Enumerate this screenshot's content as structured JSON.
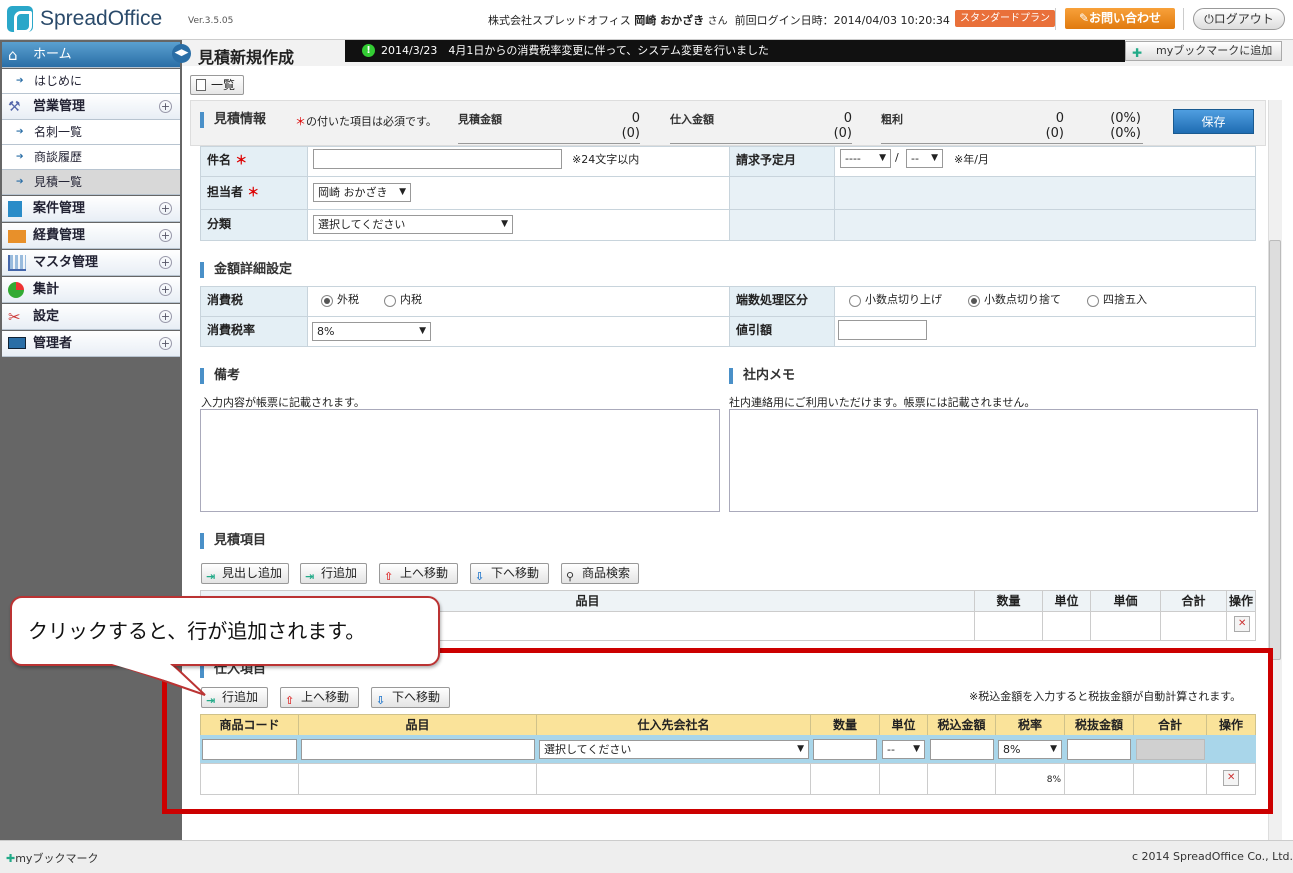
{
  "header": {
    "logo": "SpreadOffice",
    "version": "Ver.3.5.05",
    "company": "株式会社スプレッドオフィス",
    "user_name": "岡崎 おかざき",
    "user_suffix": "さん",
    "last_login": "前回ログイン日時：2014/04/03 10:20:34",
    "plan": "スタンダードプラン",
    "contact": "お問い合わせ",
    "logout": "ログアウト"
  },
  "sidebar": {
    "items": [
      {
        "label": "ホーム",
        "type": "home"
      },
      {
        "label": "はじめに",
        "type": "sub"
      },
      {
        "label": "営業管理",
        "type": "group"
      },
      {
        "label": "名刺一覧",
        "type": "sub"
      },
      {
        "label": "商談履歴",
        "type": "sub"
      },
      {
        "label": "見積一覧",
        "type": "sub",
        "active": true
      },
      {
        "label": "案件管理",
        "type": "group"
      },
      {
        "label": "経費管理",
        "type": "group"
      },
      {
        "label": "マスタ管理",
        "type": "group"
      },
      {
        "label": "集計",
        "type": "group"
      },
      {
        "label": "設定",
        "type": "group"
      },
      {
        "label": "管理者",
        "type": "group"
      }
    ]
  },
  "titlebar": {
    "title": "見積新規作成",
    "notice": "2014/3/23　4月1日からの消費税率変更に伴って、システム変更を行いました",
    "bookmark_add": "myブックマークに追加"
  },
  "list_button": "一覧",
  "summary": {
    "title": "見積情報",
    "required_note": "の付いた項目は必須です。",
    "estimate_label": "見積金額",
    "estimate_value": "0",
    "estimate_sub": "(0)",
    "purchase_label": "仕入金額",
    "purchase_value": "0",
    "purchase_sub": "(0)",
    "profit_label": "粗利",
    "profit_value": "0",
    "profit_sub": "(0)",
    "profit_pct": "(0%)",
    "profit_pct_sub": "(0%)",
    "save": "保存"
  },
  "form": {
    "subject_label": "件名",
    "subject_value": "",
    "subject_note": "※24文字以内",
    "billing_label": "請求予定月",
    "billing_year": "----",
    "billing_sep": "/",
    "billing_month": "--",
    "billing_note": "※年/月",
    "owner_label": "担当者",
    "owner_value": "岡崎 おかざき",
    "category_label": "分類",
    "category_value": "選択してください"
  },
  "amount": {
    "title": "金額詳細設定",
    "tax_label": "消費税",
    "tax_opt1": "外税",
    "tax_opt2": "内税",
    "rounding_label": "端数処理区分",
    "round_opt1": "小数点切り上げ",
    "round_opt2": "小数点切り捨て",
    "round_opt3": "四捨五入",
    "rate_label": "消費税率",
    "rate_value": "8%",
    "discount_label": "値引額",
    "discount_value": ""
  },
  "remarks": {
    "title": "備考",
    "note": "入力内容が帳票に記載されます。",
    "memo_title": "社内メモ",
    "memo_note": "社内連絡用にご利用いただけます。帳票には記載されません。"
  },
  "estimate_items": {
    "title": "見積項目",
    "btn_heading": "見出し追加",
    "btn_row": "行追加",
    "btn_up": "上へ移動",
    "btn_down": "下へ移動",
    "btn_search": "商品検索",
    "columns": [
      "品目",
      "数量",
      "単位",
      "単価",
      "合計",
      "操作"
    ]
  },
  "purchase_items": {
    "title": "仕入項目",
    "btn_row": "行追加",
    "btn_up": "上へ移動",
    "btn_down": "下へ移動",
    "note": "※税込金額を入力すると税抜金額が自動計算されます。",
    "columns": [
      "商品コード",
      "品目",
      "仕入先会社名",
      "数量",
      "単位",
      "税込金額",
      "税率",
      "税抜金額",
      "合計",
      "操作"
    ],
    "supplier_value": "選択してください",
    "unit_value": "--",
    "rate_value": "8%",
    "rate_display": "8%"
  },
  "callout": "クリックすると、行が追加されます。",
  "footer": {
    "bookmark": "myブックマーク",
    "copyright": "c 2014 SpreadOffice Co., Ltd."
  }
}
